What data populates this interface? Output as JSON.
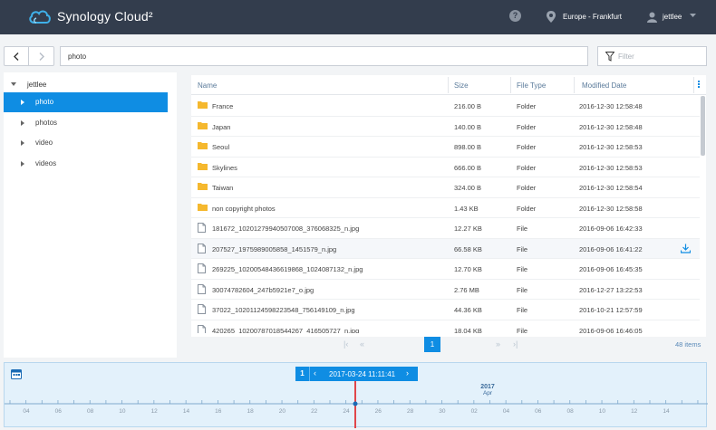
{
  "header": {
    "app_title": "Synology Cloud²",
    "help_icon": "help-circle-icon",
    "region": "Europe - Frankfurt",
    "user": "jettlee"
  },
  "toolbar": {
    "path_value": "photo",
    "filter_placeholder": "Filter"
  },
  "sidebar": {
    "root": "jettlee",
    "items": [
      {
        "label": "photo",
        "active": true
      },
      {
        "label": "photos",
        "active": false
      },
      {
        "label": "video",
        "active": false
      },
      {
        "label": "videos",
        "active": false
      }
    ]
  },
  "filelist": {
    "columns": [
      "Name",
      "Size",
      "File Type",
      "Modified Date"
    ],
    "rows": [
      {
        "name": "France",
        "size": "216.00 B",
        "type": "Folder",
        "date": "2016-12-30 12:58:48",
        "kind": "folder"
      },
      {
        "name": "Japan",
        "size": "140.00 B",
        "type": "Folder",
        "date": "2016-12-30 12:58:48",
        "kind": "folder"
      },
      {
        "name": "Seoul",
        "size": "898.00 B",
        "type": "Folder",
        "date": "2016-12-30 12:58:53",
        "kind": "folder"
      },
      {
        "name": "Skylines",
        "size": "666.00 B",
        "type": "Folder",
        "date": "2016-12-30 12:58:53",
        "kind": "folder"
      },
      {
        "name": "Taiwan",
        "size": "324.00 B",
        "type": "Folder",
        "date": "2016-12-30 12:58:54",
        "kind": "folder"
      },
      {
        "name": "non copyright photos",
        "size": "1.43 KB",
        "type": "Folder",
        "date": "2016-12-30 12:58:58",
        "kind": "folder"
      },
      {
        "name": "181672_10201279940507008_376068325_n.jpg",
        "size": "12.27 KB",
        "type": "File",
        "date": "2016-09-06 16:42:33",
        "kind": "file"
      },
      {
        "name": "207527_1975989005858_1451579_n.jpg",
        "size": "66.58 KB",
        "type": "File",
        "date": "2016-09-06 16:41:22",
        "kind": "file",
        "hover": true
      },
      {
        "name": "269225_10200548436619868_1024087132_n.jpg",
        "size": "12.70 KB",
        "type": "File",
        "date": "2016-09-06 16:45:35",
        "kind": "file"
      },
      {
        "name": "30074782604_247b5921e7_o.jpg",
        "size": "2.76 MB",
        "type": "File",
        "date": "2016-12-27 13:22:53",
        "kind": "file"
      },
      {
        "name": "37022_10201124598223548_756149109_n.jpg",
        "size": "44.36 KB",
        "type": "File",
        "date": "2016-10-21 12:57:59",
        "kind": "file"
      },
      {
        "name": "420265_10200787018544267_416505727_n.jpg",
        "size": "18.04 KB",
        "type": "File",
        "date": "2016-09-06 16:46:05",
        "kind": "file"
      }
    ]
  },
  "pager": {
    "current": "1",
    "count": "48 items"
  },
  "timeline": {
    "count": "1",
    "datetime": "2017-03-24 11:11:41",
    "year": "2017",
    "month": "Apr",
    "ticks": [
      "04",
      "06",
      "08",
      "10",
      "12",
      "14",
      "16",
      "18",
      "20",
      "22",
      "24",
      "26",
      "28",
      "30",
      "02",
      "04",
      "06",
      "08",
      "10",
      "12",
      "14"
    ]
  },
  "colors": {
    "header_bg": "#333d4d",
    "accent": "#0f8de3",
    "folder": "#f5b82e",
    "cursor": "#e0464a"
  }
}
